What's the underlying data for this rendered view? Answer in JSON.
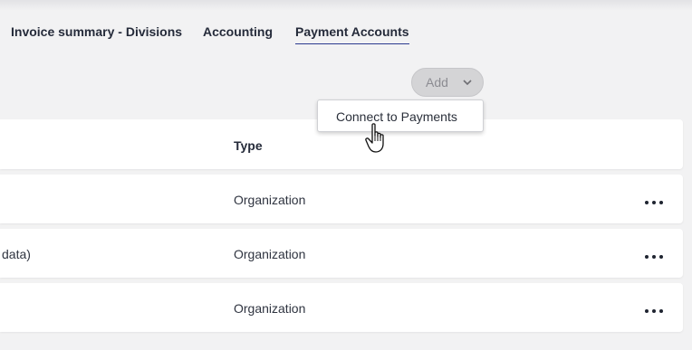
{
  "tabs": [
    {
      "label": "Invoice summary - Divisions",
      "active": false
    },
    {
      "label": "Accounting",
      "active": false
    },
    {
      "label": "Payment Accounts",
      "active": true
    }
  ],
  "toolbar": {
    "add_label": "Add",
    "add_icon": "chevron-down-icon"
  },
  "dropdown": {
    "items": [
      {
        "label": "Connect to Payments"
      }
    ]
  },
  "table": {
    "columns": {
      "type": "Type"
    },
    "rows": [
      {
        "name": "",
        "type": "Organization",
        "actions_icon": "more-horizontal-icon"
      },
      {
        "name": "data)",
        "type": "Organization",
        "actions_icon": "more-horizontal-icon"
      },
      {
        "name": "",
        "type": "Organization",
        "actions_icon": "more-horizontal-icon"
      }
    ]
  },
  "colors": {
    "accent_underline": "#2b3a8f",
    "background": "#f2f2f3",
    "card": "#ffffff",
    "button_disabled": "#d4d4d6"
  }
}
